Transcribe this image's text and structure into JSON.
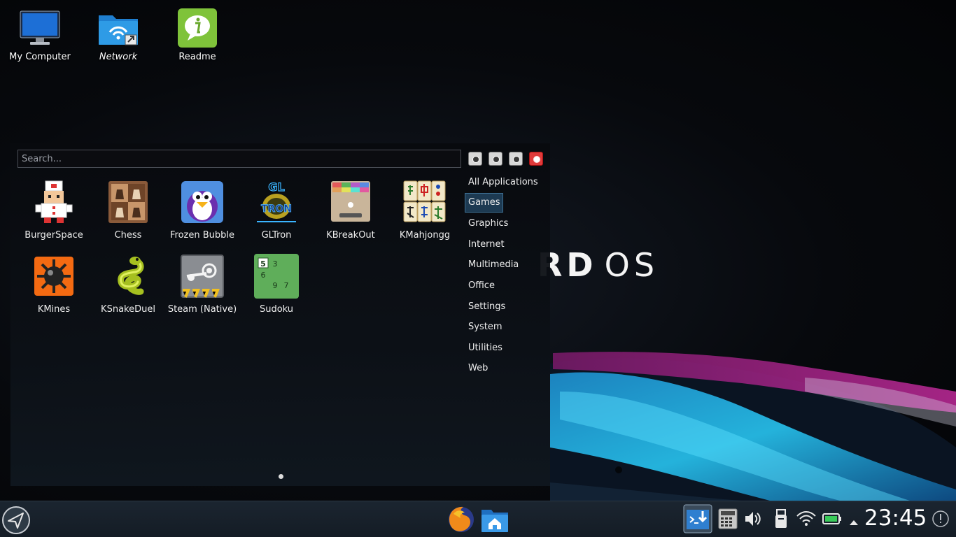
{
  "desktop": {
    "icons": [
      {
        "label": "My Computer"
      },
      {
        "label": "Network"
      },
      {
        "label": "Readme"
      }
    ],
    "brand_partial": "RD",
    "brand_os": "OS"
  },
  "launcher": {
    "search_placeholder": "Search...",
    "apps": [
      {
        "label": "BurgerSpace"
      },
      {
        "label": "Chess"
      },
      {
        "label": "Frozen Bubble"
      },
      {
        "label": "GLTron"
      },
      {
        "label": "KBreakOut"
      },
      {
        "label": "KMahjongg"
      },
      {
        "label": "KMines"
      },
      {
        "label": "KSnakeDuel"
      },
      {
        "label": "Steam (Native)"
      },
      {
        "label": "Sudoku"
      }
    ],
    "categories": [
      {
        "label": "All Applications"
      },
      {
        "label": "Games",
        "active": true
      },
      {
        "label": "Graphics"
      },
      {
        "label": "Internet"
      },
      {
        "label": "Multimedia"
      },
      {
        "label": "Office"
      },
      {
        "label": "Settings"
      },
      {
        "label": "System"
      },
      {
        "label": "Utilities"
      },
      {
        "label": "Web"
      }
    ],
    "gltron_logo_text": "GL",
    "gltron_logo_sub": "TRON",
    "sudoku_digits": [
      "5",
      "3",
      "6",
      "9",
      "7"
    ]
  },
  "taskbar": {
    "clock": "23:45"
  },
  "colors": {
    "accent_active": "#1d3a52",
    "taskbar_bg": "#1b2530",
    "close_button": "#e03a3a"
  },
  "icons": {
    "launcher": "paper-plane-icon",
    "browser": "firefox-icon",
    "files": "home-folder-icon",
    "tray": [
      "terminal-download-icon",
      "calculator-icon",
      "volume-icon",
      "usb-drive-icon",
      "wifi-icon",
      "battery-icon",
      "tray-expand-icon",
      "notifications-icon"
    ]
  }
}
